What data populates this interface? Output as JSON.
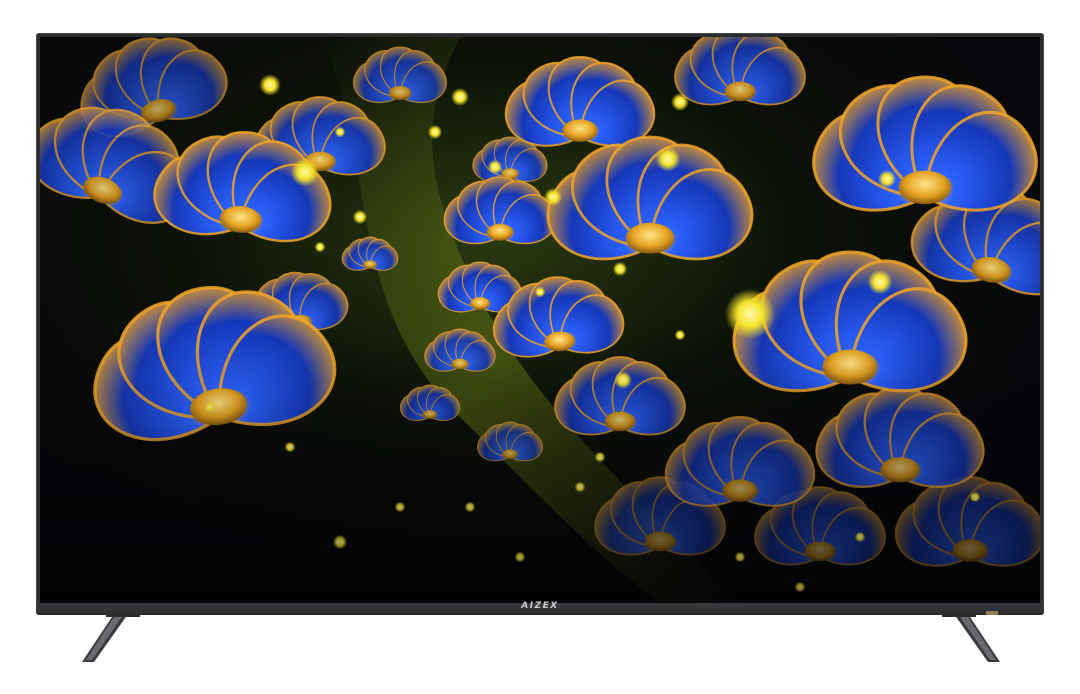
{
  "product": {
    "brand": "AIZEX"
  },
  "screen": {
    "wallpaper": "fractal-blue-flowers",
    "colors": {
      "petal": "#1b4fd8",
      "petal_glow": "#f3a81f",
      "sparkle": "#f6e52a",
      "background": "#06070b"
    }
  },
  "frame": {
    "color": "#2b2c2e",
    "indicator_color": "#8a7f55"
  }
}
